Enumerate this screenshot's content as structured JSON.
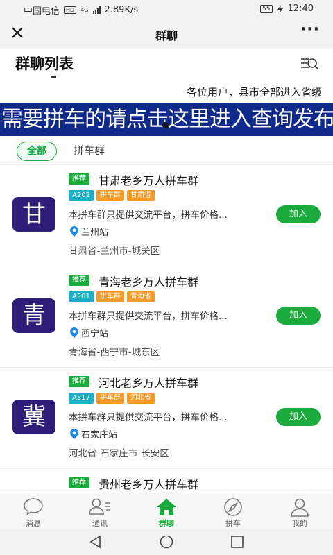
{
  "status_bar": {
    "carrier": "中国电信",
    "hd": "HD",
    "network": "4G",
    "speed": "2.89K/s",
    "battery": "55",
    "time": "12:40"
  },
  "nav": {
    "title": "群聊",
    "close_icon": "close-icon",
    "more_icon": "more-dots-icon",
    "more_glyph": "···"
  },
  "list_header": {
    "title": "群聊列表",
    "search_icon": "list-search-icon"
  },
  "notice": "各位用户，县市全部进入省级",
  "banner": "需要拼车的请点击这里进入查询发布",
  "filters": {
    "all": "全部",
    "groups": "拼车群"
  },
  "groups": [
    {
      "badge": "推荐",
      "name": "甘肃老乡万人拼车群",
      "avatar_char": "甘",
      "members": "202",
      "tag1": "拼车群",
      "tag2": "甘肃省",
      "desc": "本拼车群只提供交流平台，拼车价格...",
      "station": "兰州站",
      "region": "甘肃省-兰州市-城关区",
      "join_label": "加入"
    },
    {
      "badge": "推荐",
      "name": "青海老乡万人拼车群",
      "avatar_char": "青",
      "members": "201",
      "tag1": "拼车群",
      "tag2": "青海省",
      "desc": "本拼车群只提供交流平台，拼车价格...",
      "station": "西宁站",
      "region": "青海省-西宁市-城东区",
      "join_label": "加入"
    },
    {
      "badge": "推荐",
      "name": "河北老乡万人拼车群",
      "avatar_char": "冀",
      "members": "317",
      "tag1": "拼车群",
      "tag2": "河北省",
      "desc": "本拼车群只提供交流平台，拼车价格...",
      "station": "石家庄站",
      "region": "河北省-石家庄市-长安区",
      "join_label": "加入"
    },
    {
      "badge": "推荐",
      "name": "贵州老乡万人拼车群"
    }
  ],
  "tabbar": {
    "items": [
      {
        "label": "消息",
        "icon": "message-icon"
      },
      {
        "label": "通讯",
        "icon": "contacts-icon"
      },
      {
        "label": "群聊",
        "icon": "home-icon",
        "active": true
      },
      {
        "label": "拼车",
        "icon": "compass-icon"
      },
      {
        "label": "我的",
        "icon": "profile-icon"
      }
    ]
  },
  "colors": {
    "accent_green": "#1aab3c",
    "banner_blue": "#102a8c",
    "avatar_purple": "#2e1e7a",
    "tag_cyan": "#1ab0c8",
    "tag_orange": "#f59a26"
  }
}
